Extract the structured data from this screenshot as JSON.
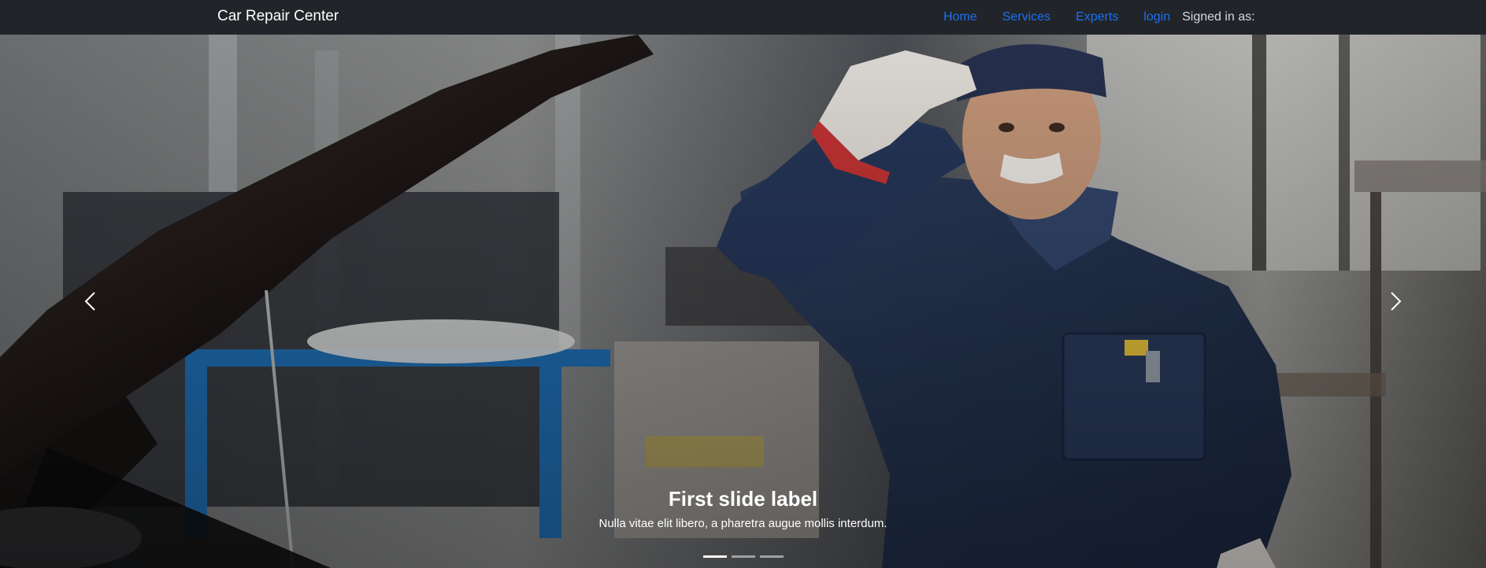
{
  "navbar": {
    "brand": "Car Repair Center",
    "links": [
      {
        "label": "Home"
      },
      {
        "label": "Services"
      },
      {
        "label": "Experts"
      },
      {
        "label": "login"
      }
    ],
    "signed_in_text": "Signed in as:",
    "background": "#212529",
    "link_color": "#1a6ff2"
  },
  "carousel": {
    "slides": [
      {
        "label": "First slide label",
        "text": "Nulla vitae elit libero, a pharetra augue mollis interdum.",
        "image": "mechanic-in-garage-photo"
      }
    ],
    "active_index": 0,
    "indicator_count": 3,
    "prev_icon": "chevron-left-icon",
    "next_icon": "chevron-right-icon"
  }
}
